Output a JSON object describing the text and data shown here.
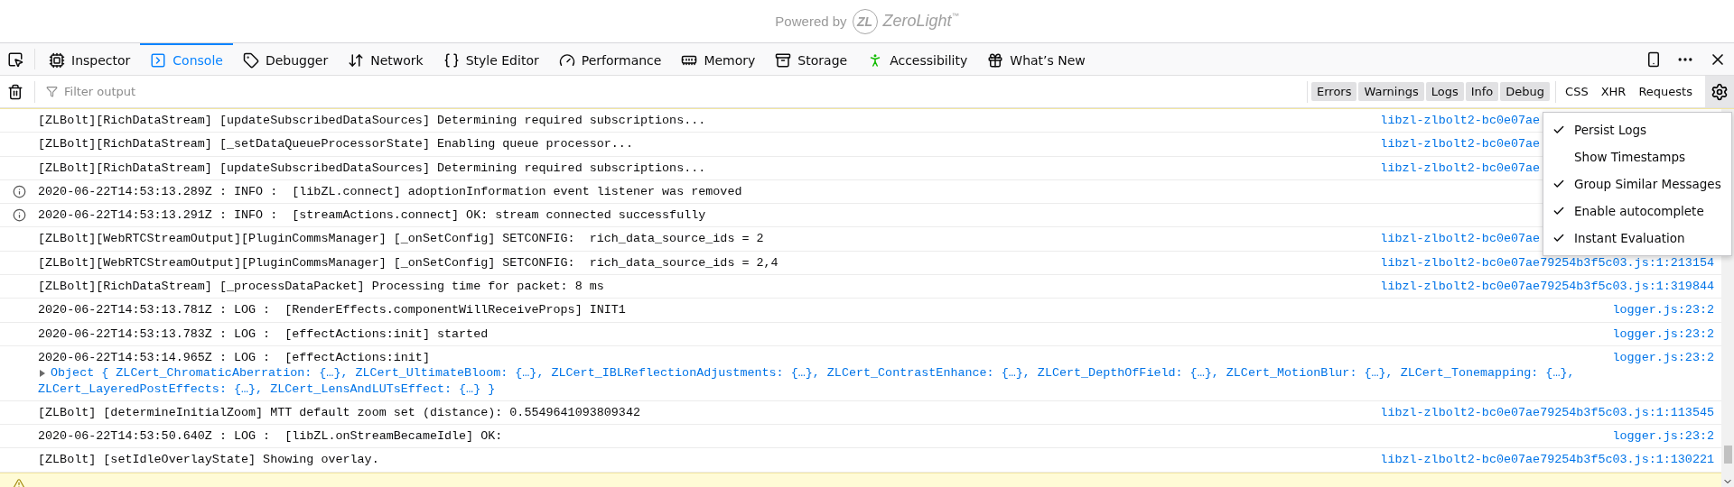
{
  "banner": {
    "powered_by": "Powered by",
    "logo_mark": "ZL",
    "brand": "ZeroLight",
    "trademark": "™"
  },
  "tabs": [
    {
      "kind": "inspector",
      "label": "Inspector",
      "selected": false
    },
    {
      "kind": "console",
      "label": "Console",
      "selected": true
    },
    {
      "kind": "debugger",
      "label": "Debugger",
      "selected": false
    },
    {
      "kind": "network",
      "label": "Network",
      "selected": false
    },
    {
      "kind": "style",
      "label": "Style Editor",
      "selected": false
    },
    {
      "kind": "performance",
      "label": "Performance",
      "selected": false
    },
    {
      "kind": "memory",
      "label": "Memory",
      "selected": false
    },
    {
      "kind": "storage",
      "label": "Storage",
      "selected": false
    },
    {
      "kind": "accessibility",
      "label": "Accessibility",
      "selected": false
    },
    {
      "kind": "whatsnew",
      "label": "What’s New",
      "selected": false
    }
  ],
  "filter": {
    "placeholder": "Filter output"
  },
  "levels": [
    {
      "label": "Errors",
      "selected": true
    },
    {
      "label": "Warnings",
      "selected": true
    },
    {
      "label": "Logs",
      "selected": true
    },
    {
      "label": "Info",
      "selected": true
    },
    {
      "label": "Debug",
      "selected": true
    }
  ],
  "extra_filters": [
    {
      "label": "CSS",
      "selected": false
    },
    {
      "label": "XHR",
      "selected": false
    },
    {
      "label": "Requests",
      "selected": false
    }
  ],
  "messages": [
    {
      "kind": "log",
      "text": "[ZLBolt][RichDataStream] [updateSubscribedDataSources] Determining required subscriptions...",
      "source": "libzl-zlbolt2-bc0e07ae",
      "truncated": true
    },
    {
      "kind": "log",
      "text": "[ZLBolt][RichDataStream] [_setDataQueueProcessorState] Enabling queue processor...",
      "source": "libzl-zlbolt2-bc0e07ae",
      "truncated": true
    },
    {
      "kind": "log",
      "text": "[ZLBolt][RichDataStream] [updateSubscribedDataSources] Determining required subscriptions...",
      "source": "libzl-zlbolt2-bc0e07ae",
      "truncated": true
    },
    {
      "kind": "info",
      "text": "2020-06-22T14:53:13.289Z : INFO :  [libZL.connect] adoptionInformation event listener was removed"
    },
    {
      "kind": "info",
      "text": "2020-06-22T14:53:13.291Z : INFO :  [streamActions.connect] OK: stream connected successfully"
    },
    {
      "kind": "log",
      "text": "[ZLBolt][WebRTCStreamOutput][PluginCommsManager] [_onSetConfig] SETCONFIG:  rich_data_source_ids = 2",
      "source": "libzl-zlbolt2-bc0e07ae",
      "truncated": true
    },
    {
      "kind": "log",
      "text": "[ZLBolt][WebRTCStreamOutput][PluginCommsManager] [_onSetConfig] SETCONFIG:  rich_data_source_ids = 2,4",
      "source": "libzl-zlbolt2-bc0e07ae79254b3f5c03.js:1:213154"
    },
    {
      "kind": "log",
      "text": "[ZLBolt][RichDataStream] [_processDataPacket] Processing time for packet: 8 ms",
      "source": "libzl-zlbolt2-bc0e07ae79254b3f5c03.js:1:319844"
    },
    {
      "kind": "log",
      "text": "2020-06-22T14:53:13.781Z : LOG :  [RenderEffects.componentWillReceiveProps] INIT1",
      "source": "logger.js:23:2"
    },
    {
      "kind": "log",
      "text": "2020-06-22T14:53:13.783Z : LOG :  [effectActions:init] started",
      "source": "logger.js:23:2"
    },
    {
      "kind": "log",
      "text": "2020-06-22T14:53:14.965Z : LOG :  [effectActions:init]",
      "source": "logger.js:23:2",
      "object": {
        "expanded": false,
        "lines": [
          "Object { ZLCert_ChromaticAberration: {…}, ZLCert_UltimateBloom: {…}, ZLCert_IBLReflectionAdjustments: {…}, ZLCert_ContrastEnhance: {…}, ZLCert_DepthOfField: {…}, ZLCert_MotionBlur: {…}, ZLCert_Tonemapping: {…},",
          "ZLCert_LayeredPostEffects: {…}, ZLCert_LensAndLUTsEffect: {…} }"
        ]
      }
    },
    {
      "kind": "log",
      "text": "[ZLBolt] [determineInitialZoom] MTT default zoom set (distance): 0.5549641093809342",
      "source": "libzl-zlbolt2-bc0e07ae79254b3f5c03.js:1:113545"
    },
    {
      "kind": "log",
      "text": "2020-06-22T14:53:50.640Z : LOG :  [libZL.onStreamBecameIdle] OK:",
      "source": "logger.js:23:2"
    },
    {
      "kind": "log",
      "text": "[ZLBolt] [setIdleOverlayState] Showing overlay.",
      "source": "libzl-zlbolt2-bc0e07ae79254b3f5c03.js:1:130221"
    },
    {
      "kind": "warning"
    }
  ],
  "settings_menu": [
    {
      "label": "Persist Logs",
      "checked": true
    },
    {
      "label": "Show Timestamps",
      "checked": false
    },
    {
      "label": "Group Similar Messages",
      "checked": true
    },
    {
      "label": "Enable autocomplete",
      "checked": true
    },
    {
      "label": "Instant Evaluation",
      "checked": true
    }
  ]
}
